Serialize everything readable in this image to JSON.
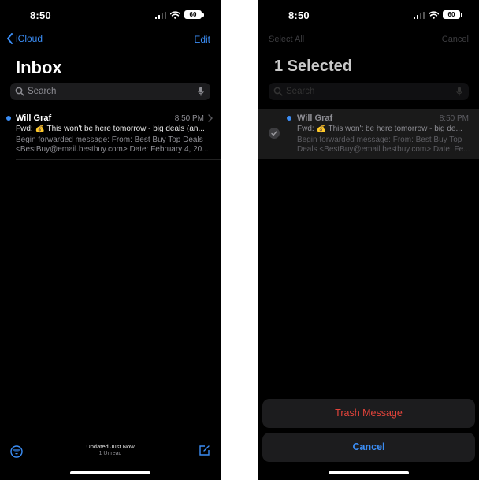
{
  "left": {
    "status": {
      "time": "8:50",
      "battery": "60"
    },
    "nav": {
      "back_label": "iCloud",
      "edit_label": "Edit"
    },
    "title": "Inbox",
    "search": {
      "placeholder": "Search"
    },
    "mail": {
      "sender": "Will Graf",
      "time": "8:50 PM",
      "subject": "Fwd: 💰 This won't be here tomorrow - big deals (an...",
      "preview_line1": "Begin forwarded message: From: Best Buy Top Deals",
      "preview_line2": "<BestBuy@email.bestbuy.com> Date: February 4, 20..."
    },
    "toolbar": {
      "update_status": "Updated Just Now",
      "unread_count": "1 Unread"
    }
  },
  "right": {
    "status": {
      "time": "8:50",
      "battery": "60"
    },
    "nav": {
      "select_all_label": "Select All",
      "cancel_label": "Cancel"
    },
    "title": "1 Selected",
    "search": {
      "placeholder": "Search"
    },
    "mail": {
      "sender": "Will Graf",
      "time": "8:50 PM",
      "subject": "Fwd: 💰 This won't be here tomorrow - big de...",
      "preview_line1": "Begin forwarded message: From: Best Buy Top",
      "preview_line2": "Deals <BestBuy@email.bestbuy.com> Date: Fe..."
    },
    "actions": {
      "trash_label": "Trash Message",
      "cancel_label": "Cancel"
    }
  },
  "colors": {
    "accent": "#3b8df5",
    "destructive": "#e5443b",
    "background": "#000000"
  },
  "icons": [
    "chevron-left-icon",
    "search-icon",
    "microphone-icon",
    "chevron-right-icon",
    "filter-icon",
    "compose-icon",
    "checkmark-icon",
    "wifi-icon",
    "signal-icon",
    "battery-icon"
  ]
}
